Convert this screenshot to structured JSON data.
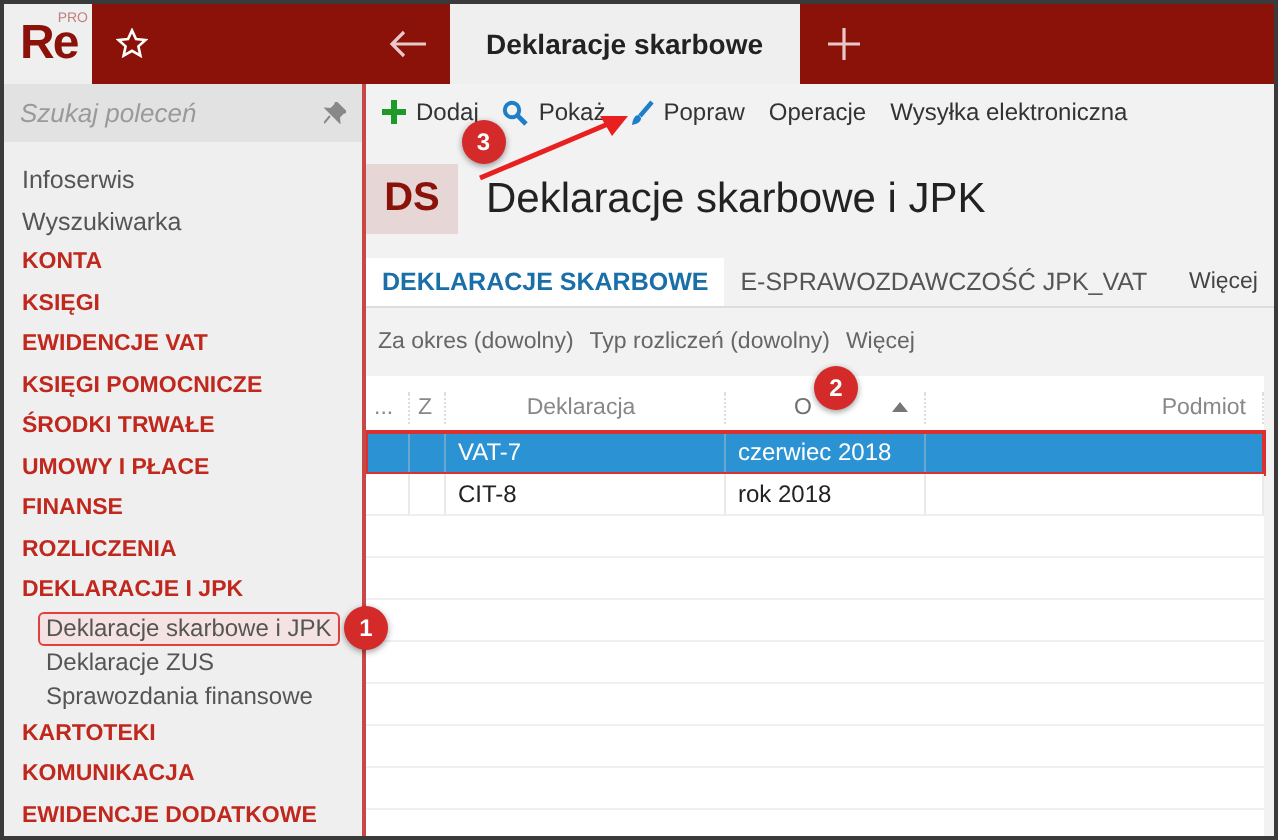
{
  "app": {
    "logo": "Re",
    "edition": "PRO"
  },
  "tabs": [
    {
      "label": "Deklaracje skarbowe",
      "selected": true
    }
  ],
  "sidebar": {
    "search": {
      "placeholder": "Szukaj poleceń"
    },
    "items": [
      {
        "label": "Infoserwis",
        "kind": "link"
      },
      {
        "label": "Wyszukiwarka",
        "kind": "link"
      },
      {
        "label": "KONTA",
        "kind": "section"
      },
      {
        "label": "KSIĘGI",
        "kind": "section"
      },
      {
        "label": "EWIDENCJE VAT",
        "kind": "section"
      },
      {
        "label": "KSIĘGI POMOCNICZE",
        "kind": "section"
      },
      {
        "label": "ŚRODKI TRWAŁE",
        "kind": "section"
      },
      {
        "label": "UMOWY I PŁACE",
        "kind": "section"
      },
      {
        "label": "FINANSE",
        "kind": "section"
      },
      {
        "label": "ROZLICZENIA",
        "kind": "section"
      },
      {
        "label": "DEKLARACJE I JPK",
        "kind": "section",
        "children": [
          {
            "label": "Deklaracje skarbowe i JPK",
            "selected": true,
            "callout": "1"
          },
          {
            "label": "Deklaracje ZUS",
            "selected": false
          },
          {
            "label": "Sprawozdania finansowe",
            "selected": false
          }
        ]
      },
      {
        "label": "KARTOTEKI",
        "kind": "section"
      },
      {
        "label": "KOMUNIKACJA",
        "kind": "section"
      },
      {
        "label": "EWIDENCJE DODATKOWE",
        "kind": "section"
      }
    ]
  },
  "toolbar": [
    {
      "label": "Dodaj",
      "kind": "plus"
    },
    {
      "label": "Pokaż",
      "kind": "search"
    },
    {
      "label": "Popraw",
      "kind": "brush",
      "callout": "3"
    },
    {
      "label": "Operacje",
      "kind": "text"
    },
    {
      "label": "Wysyłka elektroniczna",
      "kind": "text"
    }
  ],
  "page": {
    "badge": "DS",
    "title": "Deklaracje skarbowe i JPK"
  },
  "subtabs": [
    {
      "label": "DEKLARACJE SKARBOWE",
      "selected": true
    },
    {
      "label": "E-SPRAWOZDAWCZOŚĆ JPK_VAT",
      "selected": false
    }
  ],
  "subtabs_more": "Więcej",
  "filters": [
    "Za okres (dowolny)",
    "Typ rozliczeń (dowolny)",
    "Więcej"
  ],
  "table": {
    "columns": [
      {
        "label": "...",
        "sorted": false
      },
      {
        "label": "Z",
        "sorted": false
      },
      {
        "label": "Deklaracja",
        "sorted": false
      },
      {
        "label": "O",
        "sorted": true,
        "callout": "2"
      },
      {
        "label": "Podmiot",
        "sorted": false
      }
    ],
    "rows": [
      {
        "cells": [
          "VAT-7",
          "czerwiec 2018"
        ],
        "selected": true
      },
      {
        "cells": [
          "CIT-8",
          "rok 2018"
        ],
        "selected": false
      }
    ]
  }
}
